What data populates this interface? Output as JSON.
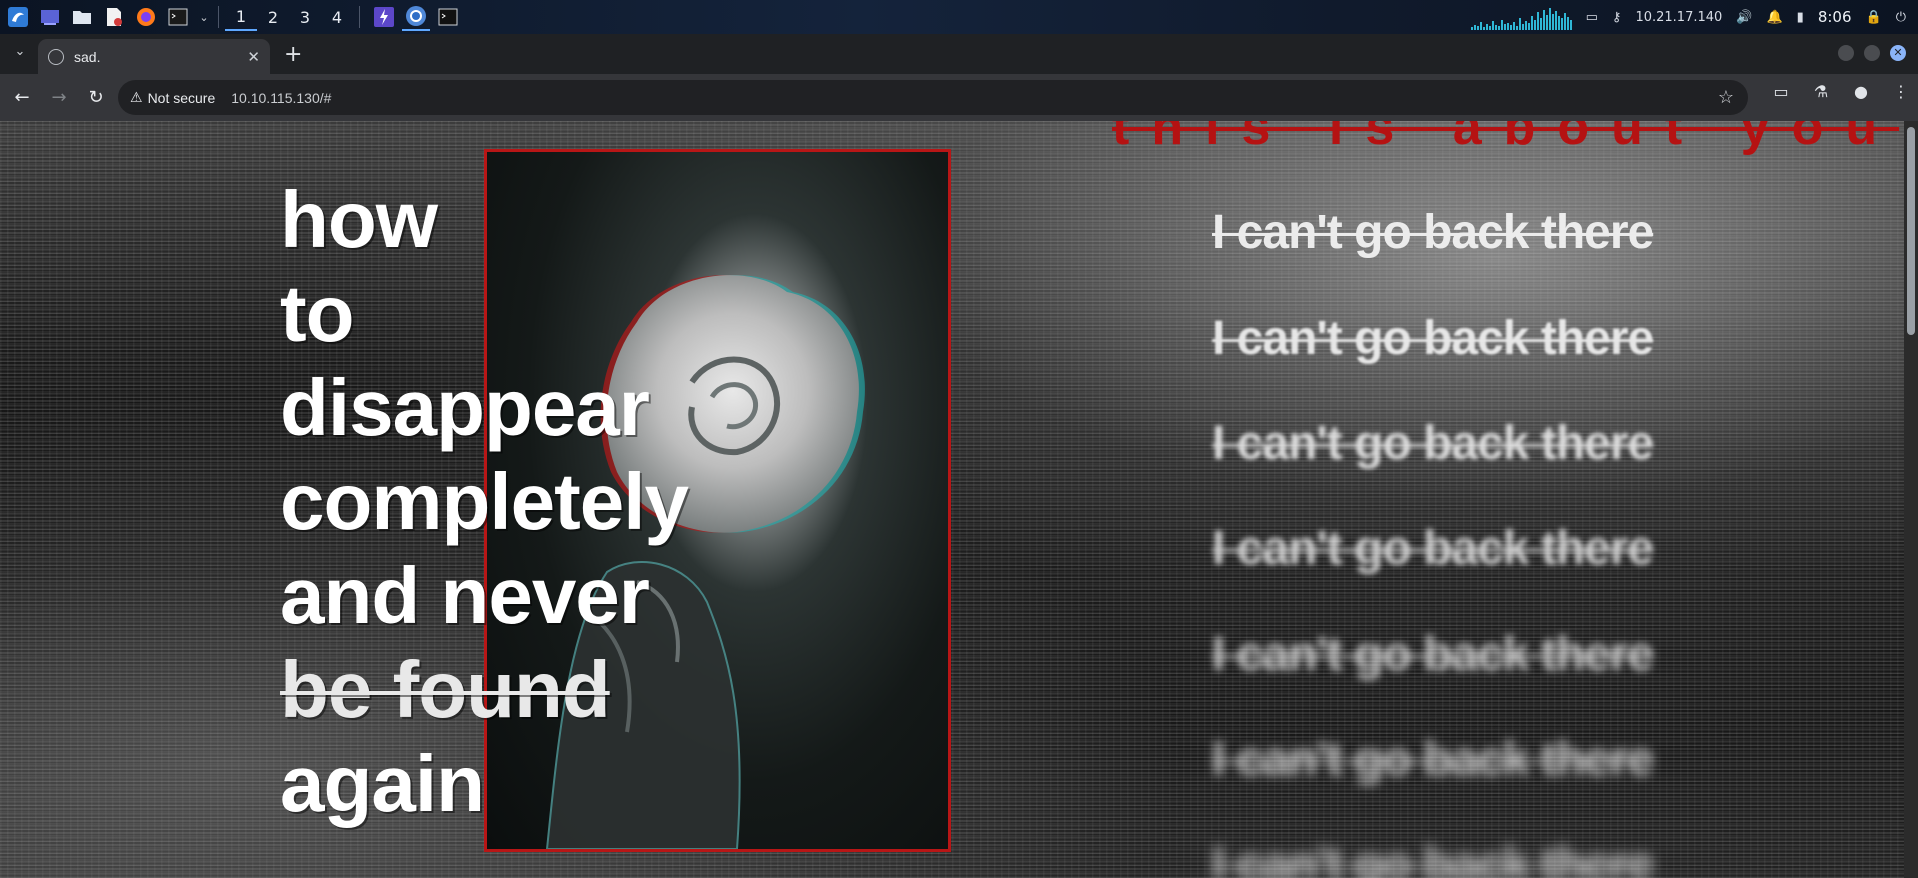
{
  "taskbar": {
    "workspaces": [
      "1",
      "2",
      "3",
      "4"
    ],
    "active_workspace": "1",
    "ip": "10.21.17.140",
    "clock": "8:06",
    "icons": [
      "kali-menu-icon",
      "desktop-icon",
      "files-icon",
      "text-editor-icon",
      "firefox-icon",
      "terminal-icon",
      "burp-icon",
      "chrome-icon",
      "terminal-small-icon"
    ]
  },
  "browser": {
    "tab_title": "sad.",
    "security_label": "Not secure",
    "url": "10.10.115.130/#"
  },
  "page": {
    "headline": [
      "how",
      "to",
      "disappear",
      "completely",
      "and never",
      "be found",
      "again"
    ],
    "top_text": "this is about you",
    "repeat_lines": [
      "I can't go back there",
      "I can't go back there",
      "I can't go back there",
      "I can't go back there",
      "I can't go back there",
      "I can't go back there",
      "I can't go back there"
    ]
  },
  "colors": {
    "accent_red": "#b81616",
    "chrome_bg": "#35363a",
    "taskbar_bg": "#0b1423"
  }
}
